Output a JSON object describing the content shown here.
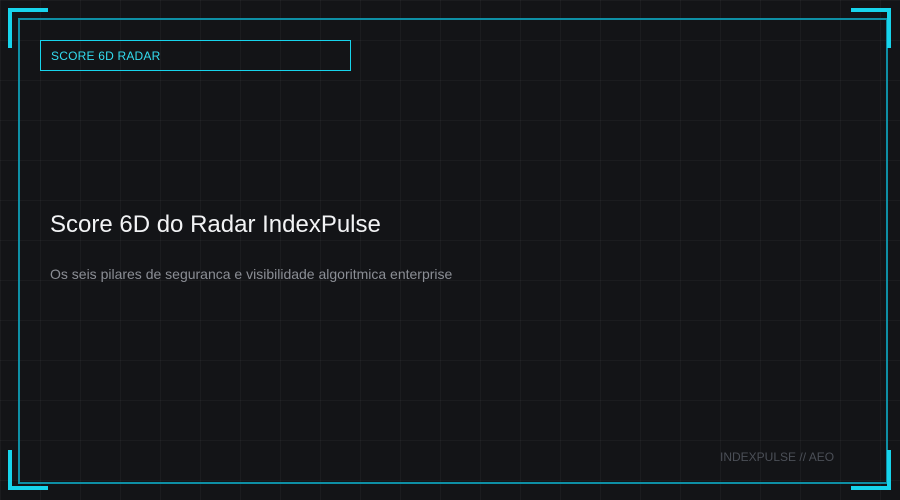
{
  "tag": {
    "label": "SCORE 6D RADAR"
  },
  "hero": {
    "title": "Score 6D do Radar IndexPulse",
    "subtitle": "Os seis pilares de seguranca e visibilidade algoritmica enterprise"
  },
  "footer": {
    "mark": "INDEXPULSE // AEO"
  },
  "colors": {
    "background": "#131417",
    "accent": "#17d4ec",
    "frame": "#0e8fa5",
    "title_text": "#f2f3f5",
    "subtitle_text": "#8b8e95"
  }
}
